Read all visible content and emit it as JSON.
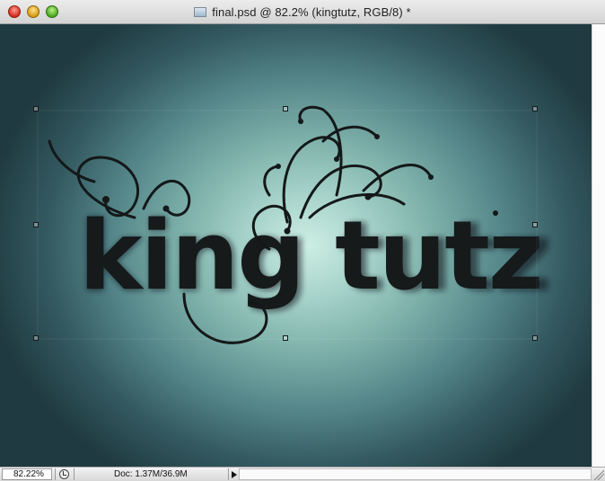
{
  "window": {
    "title": "final.psd @ 82.2% (kingtutz, RGB/8) *",
    "controls": {
      "close": "×",
      "minimize": "−",
      "maximize": "+"
    }
  },
  "canvas": {
    "artwork_text": "king tutz",
    "background_colors": {
      "center": "#cdeee4",
      "edge": "#1f3a40"
    },
    "text_color": "#161a1b"
  },
  "status_bar": {
    "zoom": "82.22%",
    "doc_info": "Doc: 1.37M/36.9M"
  },
  "icons": {
    "document": "document-icon",
    "status": "timer-icon",
    "menu": "triangle-right-icon"
  }
}
